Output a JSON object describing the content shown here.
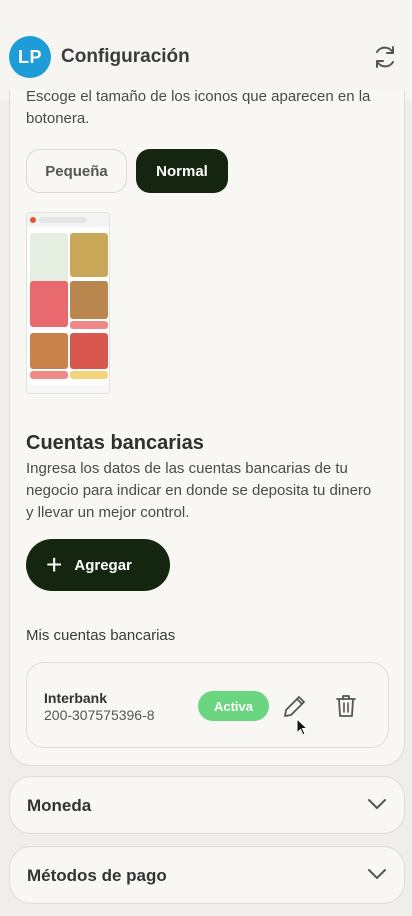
{
  "header": {
    "avatar_initials": "LP",
    "title": "Configuración",
    "refresh_icon": "refresh-icon",
    "avatar_color": "#1e9cd7"
  },
  "icon_size": {
    "description": "Escoge el tamaño de los iconos que aparecen en la botonera.",
    "options": [
      "Pequeña",
      "Normal"
    ],
    "selected": "Normal"
  },
  "bank_accounts": {
    "title": "Cuentas bancarias",
    "description": "Ingresa los datos de las cuentas bancarias de tu negocio para indicar en donde se deposita tu dinero y llevar un mejor control.",
    "add_label": "Agregar",
    "list_title": "Mis cuentas bancarias",
    "items": [
      {
        "bank": "Interbank",
        "number": "200-307575396-8",
        "status": "Activa"
      }
    ]
  },
  "sections": [
    {
      "label": "Moneda"
    },
    {
      "label": "Métodos de pago"
    }
  ],
  "colors": {
    "primary_dark": "#14260f",
    "active_badge": "#6ad67f"
  }
}
